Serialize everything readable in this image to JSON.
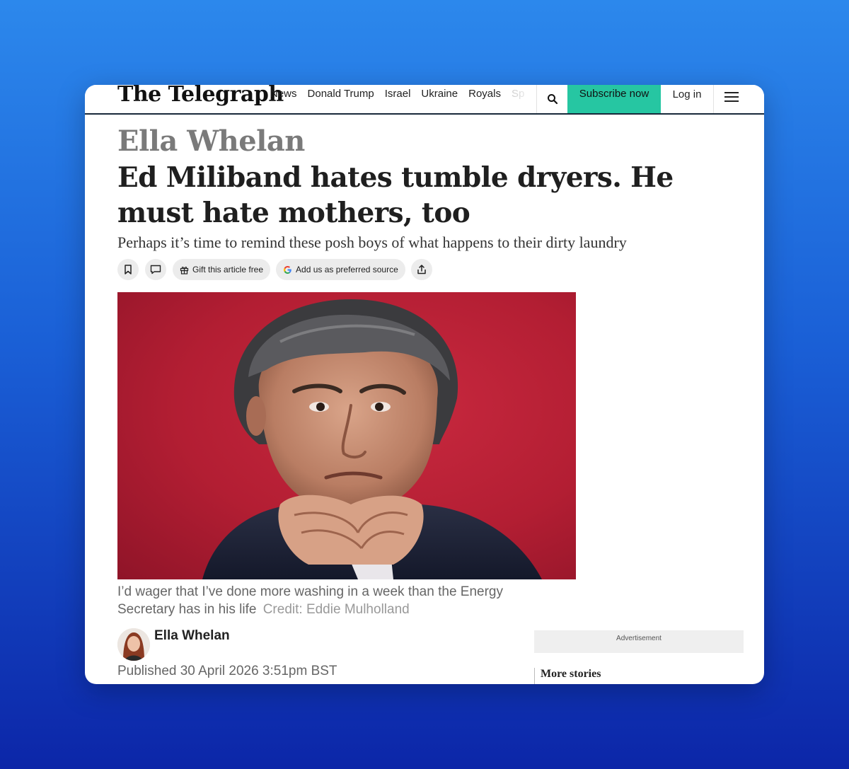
{
  "header": {
    "logo": "The Telegraph",
    "nav": [
      "News",
      "Donald Trump",
      "Israel",
      "Ukraine",
      "Royals",
      "Sp"
    ],
    "subscribe_label": "Subscribe now",
    "login_label": "Log in",
    "search_icon": "search-icon",
    "menu_icon": "hamburger-menu-icon",
    "accent_color": "#26c6a2"
  },
  "article": {
    "kicker": "Ella Whelan",
    "headline": "Ed Miliband hates tumble dryers. He must hate mothers, too",
    "standfirst": "Perhaps it’s time to remind these posh boys of what happens to their dirty laundry",
    "actions": {
      "bookmark_icon": "bookmark-icon",
      "comment_icon": "comment-icon",
      "gift_label": "Gift this article free",
      "google_label": "Add us as preferred source",
      "share_icon": "share-icon"
    },
    "caption": "I’d wager that I’ve done more washing in a week than the Energy Secretary has in his life",
    "credit": "Credit: Eddie Mulholland",
    "author": "Ella Whelan",
    "published": "Published 30 April 2026 3:51pm BST"
  },
  "rail": {
    "advertisement_label": "Advertisement",
    "more_stories_label": "More stories"
  }
}
